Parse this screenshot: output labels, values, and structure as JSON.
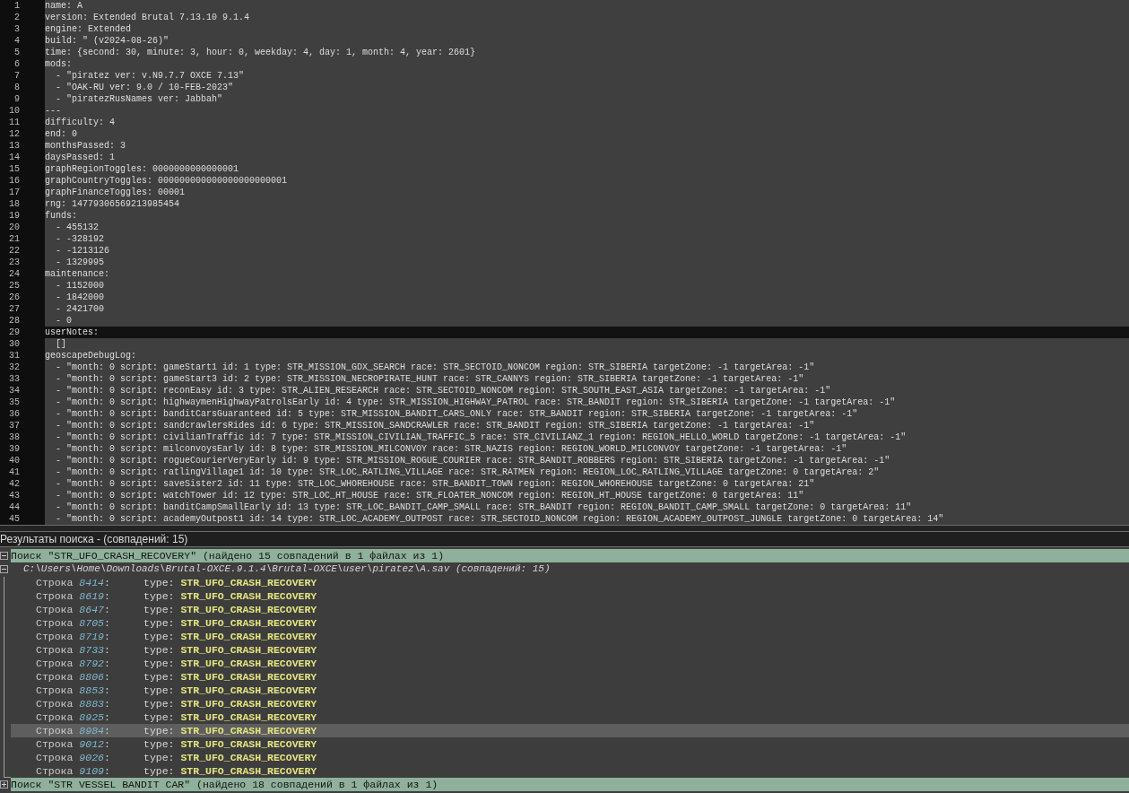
{
  "editor": {
    "lines": [
      {
        "number": "1",
        "text": "name: A",
        "selected": false
      },
      {
        "number": "2",
        "text": "version: Extended Brutal 7.13.10 9.1.4",
        "selected": false
      },
      {
        "number": "3",
        "text": "engine: Extended",
        "selected": false
      },
      {
        "number": "4",
        "text": "build: \" (v2024-08-26)\"",
        "selected": false
      },
      {
        "number": "5",
        "text": "time: {second: 30, minute: 3, hour: 0, weekday: 4, day: 1, month: 4, year: 2601}",
        "selected": false
      },
      {
        "number": "6",
        "text": "mods:",
        "selected": false
      },
      {
        "number": "7",
        "text": "  - \"piratez ver: v.N9.7.7 OXCE 7.13\"",
        "selected": false
      },
      {
        "number": "8",
        "text": "  - \"OAK-RU ver: 9.0 / 10-FEB-2023\"",
        "selected": false
      },
      {
        "number": "9",
        "text": "  - \"piratezRusNames ver: Jabbah\"",
        "selected": false
      },
      {
        "number": "10",
        "text": "---",
        "selected": false
      },
      {
        "number": "11",
        "text": "difficulty: 4",
        "selected": false
      },
      {
        "number": "12",
        "text": "end: 0",
        "selected": false
      },
      {
        "number": "13",
        "text": "monthsPassed: 3",
        "selected": false
      },
      {
        "number": "14",
        "text": "daysPassed: 1",
        "selected": false
      },
      {
        "number": "15",
        "text": "graphRegionToggles: 0000000000000001",
        "selected": false
      },
      {
        "number": "16",
        "text": "graphCountryToggles: 000000000000000000000001",
        "selected": false
      },
      {
        "number": "17",
        "text": "graphFinanceToggles: 00001",
        "selected": false
      },
      {
        "number": "18",
        "text": "rng: 14779306569213985454",
        "selected": false
      },
      {
        "number": "19",
        "text": "funds:",
        "selected": false
      },
      {
        "number": "20",
        "text": "  - 455132",
        "selected": false
      },
      {
        "number": "21",
        "text": "  - -328192",
        "selected": false
      },
      {
        "number": "22",
        "text": "  - -1213126",
        "selected": false
      },
      {
        "number": "23",
        "text": "  - 1329995",
        "selected": false
      },
      {
        "number": "24",
        "text": "maintenance:",
        "selected": false
      },
      {
        "number": "25",
        "text": "  - 1152000",
        "selected": false
      },
      {
        "number": "26",
        "text": "  - 1842000",
        "selected": false
      },
      {
        "number": "27",
        "text": "  - 2421700",
        "selected": false
      },
      {
        "number": "28",
        "text": "  - 0",
        "selected": false
      },
      {
        "number": "29",
        "text": "userNotes:",
        "selected": true
      },
      {
        "number": "30",
        "text": "  []",
        "selected": false
      },
      {
        "number": "31",
        "text": "geoscapeDebugLog:",
        "selected": false
      },
      {
        "number": "32",
        "text": "  - \"month: 0 script: gameStart1 id: 1 type: STR_MISSION_GDX_SEARCH race: STR_SECTOID_NONCOM region: STR_SIBERIA targetZone: -1 targetArea: -1\"",
        "selected": false
      },
      {
        "number": "33",
        "text": "  - \"month: 0 script: gameStart3 id: 2 type: STR_MISSION_NECROPIRATE_HUNT race: STR_CANNYS region: STR_SIBERIA targetZone: -1 targetArea: -1\"",
        "selected": false
      },
      {
        "number": "34",
        "text": "  - \"month: 0 script: reconEasy id: 3 type: STR_ALIEN_RESEARCH race: STR_SECTOID_NONCOM region: STR_SOUTH_EAST_ASIA targetZone: -1 targetArea: -1\"",
        "selected": false
      },
      {
        "number": "35",
        "text": "  - \"month: 0 script: highwaymenHighwayPatrolsEarly id: 4 type: STR_MISSION_HIGHWAY_PATROL race: STR_BANDIT region: STR_SIBERIA targetZone: -1 targetArea: -1\"",
        "selected": false
      },
      {
        "number": "36",
        "text": "  - \"month: 0 script: banditCarsGuaranteed id: 5 type: STR_MISSION_BANDIT_CARS_ONLY race: STR_BANDIT region: STR_SIBERIA targetZone: -1 targetArea: -1\"",
        "selected": false
      },
      {
        "number": "37",
        "text": "  - \"month: 0 script: sandcrawlersRides id: 6 type: STR_MISSION_SANDCRAWLER race: STR_BANDIT region: STR_SIBERIA targetZone: -1 targetArea: -1\"",
        "selected": false
      },
      {
        "number": "38",
        "text": "  - \"month: 0 script: civilianTraffic id: 7 type: STR_MISSION_CIVILIAN_TRAFFIC_5 race: STR_CIVILIANZ_1 region: REGION_HELLO_WORLD targetZone: -1 targetArea: -1\"",
        "selected": false
      },
      {
        "number": "39",
        "text": "  - \"month: 0 script: milconvoysEarly id: 8 type: STR_MISSION_MILCONVOY race: STR_NAZIS region: REGION_WORLD_MILCONVOY targetZone: -1 targetArea: -1\"",
        "selected": false
      },
      {
        "number": "40",
        "text": "  - \"month: 0 script: rogueCourierVeryEarly id: 9 type: STR_MISSION_ROGUE_COURIER race: STR_BANDIT_ROBBERS region: STR_SIBERIA targetZone: -1 targetArea: -1\"",
        "selected": false
      },
      {
        "number": "41",
        "text": "  - \"month: 0 script: ratlingVillage1 id: 10 type: STR_LOC_RATLING_VILLAGE race: STR_RATMEN region: REGION_LOC_RATLING_VILLAGE targetZone: 0 targetArea: 2\"",
        "selected": false
      },
      {
        "number": "42",
        "text": "  - \"month: 0 script: saveSister2 id: 11 type: STR_LOC_WHOREHOUSE race: STR_BANDIT_TOWN region: REGION_WHOREHOUSE targetZone: 0 targetArea: 21\"",
        "selected": false
      },
      {
        "number": "43",
        "text": "  - \"month: 0 script: watchTower id: 12 type: STR_LOC_HT_HOUSE race: STR_FLOATER_NONCOM region: REGION_HT_HOUSE targetZone: 0 targetArea: 11\"",
        "selected": false
      },
      {
        "number": "44",
        "text": "  - \"month: 0 script: banditCampSmallEarly id: 13 type: STR_LOC_BANDIT_CAMP_SMALL race: STR_BANDIT region: REGION_BANDIT_CAMP_SMALL targetZone: 0 targetArea: 11\"",
        "selected": false
      },
      {
        "number": "45",
        "text": "  - \"month: 0 script: academyOutpost1 id: 14 type: STR_LOC_ACADEMY_OUTPOST race: STR_SECTOID_NONCOM region: REGION_ACADEMY_OUTPOST_JUNGLE targetZone: 0 targetArea: 14\"",
        "selected": false
      }
    ]
  },
  "search_panel": {
    "title": "Результаты поиска - (совпадений: 15)",
    "groups": [
      {
        "label": "Поиск \"STR_UFO_CRASH_RECOVERY\" (найдено 15 совпадений в 1 файлах из 1)",
        "expanded": true,
        "files": [
          {
            "path": "C:\\Users\\Home\\Downloads\\Brutal-OXCE.9.1.4\\Brutal-OXCE\\user\\piratez\\A.sav (совпадений: 15)",
            "expanded": true,
            "results": [
              {
                "prefix": "Строка",
                "line": "8414",
                "suffix": ":",
                "text": "type:",
                "match": "STR_UFO_CRASH_RECOVERY",
                "selected": false
              },
              {
                "prefix": "Строка",
                "line": "8619",
                "suffix": ":",
                "text": "type:",
                "match": "STR_UFO_CRASH_RECOVERY",
                "selected": false
              },
              {
                "prefix": "Строка",
                "line": "8647",
                "suffix": ":",
                "text": "type:",
                "match": "STR_UFO_CRASH_RECOVERY",
                "selected": false
              },
              {
                "prefix": "Строка",
                "line": "8705",
                "suffix": ":",
                "text": "type:",
                "match": "STR_UFO_CRASH_RECOVERY",
                "selected": false
              },
              {
                "prefix": "Строка",
                "line": "8719",
                "suffix": ":",
                "text": "type:",
                "match": "STR_UFO_CRASH_RECOVERY",
                "selected": false
              },
              {
                "prefix": "Строка",
                "line": "8733",
                "suffix": ":",
                "text": "type:",
                "match": "STR_UFO_CRASH_RECOVERY",
                "selected": false
              },
              {
                "prefix": "Строка",
                "line": "8792",
                "suffix": ":",
                "text": "type:",
                "match": "STR_UFO_CRASH_RECOVERY",
                "selected": false
              },
              {
                "prefix": "Строка",
                "line": "8806",
                "suffix": ":",
                "text": "type:",
                "match": "STR_UFO_CRASH_RECOVERY",
                "selected": false
              },
              {
                "prefix": "Строка",
                "line": "8853",
                "suffix": ":",
                "text": "type:",
                "match": "STR_UFO_CRASH_RECOVERY",
                "selected": false
              },
              {
                "prefix": "Строка",
                "line": "8883",
                "suffix": ":",
                "text": "type:",
                "match": "STR_UFO_CRASH_RECOVERY",
                "selected": false
              },
              {
                "prefix": "Строка",
                "line": "8925",
                "suffix": ":",
                "text": "type:",
                "match": "STR_UFO_CRASH_RECOVERY",
                "selected": false
              },
              {
                "prefix": "Строка",
                "line": "8984",
                "suffix": ":",
                "text": "type:",
                "match": "STR_UFO_CRASH_RECOVERY",
                "selected": true
              },
              {
                "prefix": "Строка",
                "line": "9012",
                "suffix": ":",
                "text": "type:",
                "match": "STR_UFO_CRASH_RECOVERY",
                "selected": false
              },
              {
                "prefix": "Строка",
                "line": "9026",
                "suffix": ":",
                "text": "type:",
                "match": "STR_UFO_CRASH_RECOVERY",
                "selected": false
              },
              {
                "prefix": "Строка",
                "line": "9109",
                "suffix": ":",
                "text": "type:",
                "match": "STR_UFO_CRASH_RECOVERY",
                "selected": false
              }
            ]
          }
        ]
      },
      {
        "label": "Поиск \"STR VESSEL BANDIT CAR\" (найдено 18 совпадений в 1 файлах из 1)",
        "expanded": false
      }
    ]
  }
}
